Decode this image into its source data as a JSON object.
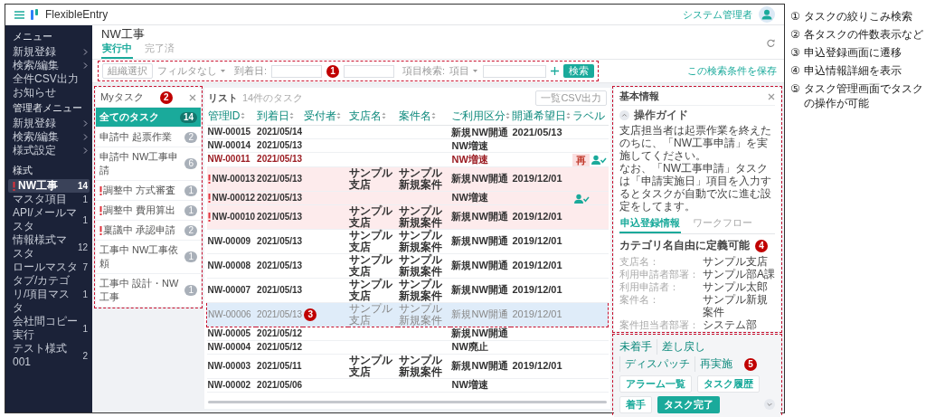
{
  "app": {
    "name": "FlexibleEntry",
    "user": "システム管理者"
  },
  "sidebar": {
    "sections": [
      {
        "heading": "メニュー",
        "items": [
          {
            "label": "新規登録",
            "submenu": true
          },
          {
            "label": "検索/編集",
            "submenu": true
          },
          {
            "label": "全件CSV出力",
            "submenu": false
          },
          {
            "label": "お知らせ",
            "submenu": false
          }
        ]
      },
      {
        "heading": "管理者メニュー",
        "items": [
          {
            "label": "新規登録",
            "submenu": true
          },
          {
            "label": "検索/編集",
            "submenu": true
          },
          {
            "label": "様式設定",
            "submenu": true
          }
        ]
      },
      {
        "heading": "様式",
        "items": [
          {
            "label": "NW工事",
            "count": "14",
            "selected": true,
            "alert": true
          },
          {
            "label": "マスタ項目",
            "count": "1",
            "selected": false,
            "alert": false
          },
          {
            "label": "API/メールマスタ",
            "count": "1",
            "selected": false,
            "alert": false
          },
          {
            "label": "情報様式マスタ",
            "count": "12",
            "selected": false,
            "alert": false
          },
          {
            "label": "ロールマスタ",
            "count": "7",
            "selected": false,
            "alert": false
          },
          {
            "label": "タブ/カテゴリ/項目マスタ",
            "count": "1",
            "selected": false,
            "alert": false
          },
          {
            "label": "会社間コピー実行",
            "count": "1",
            "selected": false,
            "alert": false
          },
          {
            "label": "テスト様式001",
            "count": "2",
            "selected": false,
            "alert": false
          }
        ]
      }
    ]
  },
  "page": {
    "title": "NW工事",
    "tabs": [
      {
        "label": "実行中",
        "selected": true
      },
      {
        "label": "完了済",
        "selected": false
      }
    ]
  },
  "filter": {
    "callout": "1",
    "org_button": "組織選択",
    "filter_select": "フィルタなし",
    "date_label": "到着日:",
    "field_label": "項目検索:",
    "field_select": "項目",
    "search_button": "検索",
    "save_link": "この検索条件を保存"
  },
  "my_tasks": {
    "title": "Myタスク",
    "callout": "2",
    "items": [
      {
        "label": "全てのタスク",
        "count": "14",
        "selected": true,
        "alert": false
      },
      {
        "label": "申請中 起票作業",
        "count": "2",
        "selected": false,
        "alert": false
      },
      {
        "label": "申請中 NW工事申請",
        "count": "6",
        "selected": false,
        "alert": false
      },
      {
        "label": "調整中 方式審査",
        "count": "1",
        "selected": false,
        "alert": true
      },
      {
        "label": "調整中 費用算出",
        "count": "1",
        "selected": false,
        "alert": true
      },
      {
        "label": "稟議中 承認申請",
        "count": "2",
        "selected": false,
        "alert": true
      },
      {
        "label": "工事中 NW工事依頼",
        "count": "1",
        "selected": false,
        "alert": false
      },
      {
        "label": "工事中 設計・NW工事",
        "count": "1",
        "selected": false,
        "alert": false
      }
    ]
  },
  "list": {
    "title": "リスト",
    "subtitle": "14件のタスク",
    "export_button": "一覧CSV出力",
    "columns": [
      {
        "label": "管理ID",
        "sortable": true
      },
      {
        "label": "到着日",
        "sortable": true
      },
      {
        "label": "受付者",
        "sortable": true
      },
      {
        "label": "支店名",
        "sortable": true
      },
      {
        "label": "案件名",
        "sortable": true
      },
      {
        "label": "ご利用区分",
        "sortable": true
      },
      {
        "label": "開通希望日",
        "sortable": true
      },
      {
        "label": "ラベル",
        "sortable": false
      }
    ],
    "rows": [
      {
        "id": "NW-00015",
        "arrival": "2021/05/14",
        "usage": "新規NW開通",
        "desired_date": "2021/05/13",
        "alert": false,
        "returned": false,
        "selected": false,
        "assigned": false
      },
      {
        "id": "NW-00014",
        "arrival": "2021/05/13",
        "usage": "NW増速",
        "alert": false,
        "returned": false,
        "selected": false,
        "assigned": false
      },
      {
        "id": "NW-00011",
        "arrival": "2021/05/13",
        "usage": "NW増速",
        "alert": false,
        "returned": true,
        "selected": false,
        "tag": "再",
        "assigned": true
      },
      {
        "id": "NW-00013",
        "arrival": "2021/05/13",
        "branch": "サンプル支店",
        "project": "サンプル新規案件",
        "usage": "新規NW開通",
        "desired_date": "2019/12/01",
        "alert": true,
        "returned": false,
        "selected": false,
        "assigned": false
      },
      {
        "id": "NW-00012",
        "arrival": "2021/05/13",
        "usage": "NW増速",
        "alert": true,
        "returned": false,
        "selected": false,
        "assigned": true
      },
      {
        "id": "NW-00010",
        "arrival": "2021/05/13",
        "branch": "サンプル支店",
        "project": "サンプル新規案件",
        "usage": "新規NW開通",
        "desired_date": "2019/12/01",
        "alert": true,
        "returned": false,
        "selected": false,
        "assigned": false
      },
      {
        "id": "NW-00009",
        "arrival": "2021/05/13",
        "branch": "サンプル支店",
        "project": "サンプル新規案件",
        "usage": "新規NW開通",
        "desired_date": "2019/12/01",
        "alert": false,
        "returned": false,
        "selected": false,
        "assigned": false
      },
      {
        "id": "NW-00008",
        "arrival": "2021/05/13",
        "branch": "サンプル支店",
        "project": "サンプル新規案件",
        "usage": "新規NW開通",
        "desired_date": "2019/12/01",
        "alert": false,
        "returned": false,
        "selected": false,
        "assigned": false
      },
      {
        "id": "NW-00007",
        "arrival": "2021/05/13",
        "branch": "サンプル支店",
        "project": "サンプル新規案件",
        "usage": "新規NW開通",
        "desired_date": "2019/12/01",
        "alert": false,
        "returned": false,
        "selected": false,
        "assigned": false
      },
      {
        "id": "NW-00006",
        "arrival": "2021/05/13",
        "branch": "サンプル支店",
        "project": "サンプル新規案件",
        "usage": "新規NW開通",
        "desired_date": "2019/12/01",
        "alert": false,
        "returned": false,
        "selected": true,
        "assigned": false,
        "callout": "3"
      },
      {
        "id": "NW-00005",
        "arrival": "2021/05/12",
        "usage": "新規NW開通",
        "alert": false,
        "returned": false,
        "selected": false,
        "assigned": false
      },
      {
        "id": "NW-00004",
        "arrival": "2021/05/12",
        "usage": "NW廃止",
        "alert": false,
        "returned": false,
        "selected": false,
        "assigned": false
      },
      {
        "id": "NW-00003",
        "arrival": "2021/05/11",
        "branch": "サンプル支店",
        "project": "サンプル新規案件",
        "usage": "新規NW開通",
        "desired_date": "2019/12/01",
        "alert": false,
        "returned": false,
        "selected": false,
        "assigned": false
      },
      {
        "id": "NW-00002",
        "arrival": "2021/05/06",
        "usage": "NW増速",
        "alert": false,
        "returned": false,
        "selected": false,
        "assigned": false
      }
    ]
  },
  "detail": {
    "title": "基本情報",
    "callout": "4",
    "guide": {
      "title": "操作ガイド",
      "expanded": true,
      "paragraphs": [
        "支店担当者は起票作業を終えたのちに、「NW工事申請」を実施してください。",
        "なお、「NW工事申請」タスクは「申請実施日」項目を入力するとタスクが自動で次に進む設定をしてます。"
      ]
    },
    "tabs": [
      {
        "label": "申込登録情報",
        "selected": true
      },
      {
        "label": "ワークフロー",
        "selected": false
      }
    ],
    "category": "カテゴリ名自由に定義可能",
    "fields": [
      {
        "label": "支店名：",
        "value": "サンプル支店"
      },
      {
        "label": "利用申請者部署：",
        "value": "サンプル部A課"
      },
      {
        "label": "利用申請者：",
        "value": "サンプル太郎"
      },
      {
        "label": "案件名：",
        "value": "サンプル新規案件"
      },
      {
        "label": "案件担当者部署：",
        "value": "システム部"
      }
    ]
  },
  "actions": {
    "callout": "5",
    "links": [
      "未着手",
      "差し戻し",
      "ディスパッチ",
      "再実施"
    ],
    "buttons": [
      {
        "label": "アラーム一覧",
        "kind": "outline"
      },
      {
        "label": "タスク履歴",
        "kind": "outline"
      },
      {
        "label": "着手",
        "kind": "outline"
      },
      {
        "label": "タスク完了",
        "kind": "primary"
      }
    ]
  },
  "notes": [
    {
      "marker": "①",
      "text": "タスクの絞りこみ検索"
    },
    {
      "marker": "②",
      "text": "各タスクの件数表示など"
    },
    {
      "marker": "③",
      "text": "申込登録画面に遷移"
    },
    {
      "marker": "④",
      "text": "申込情報詳細を表示"
    },
    {
      "marker": "⑤",
      "text": "タスク管理画面でタスクの操作が可能"
    }
  ]
}
